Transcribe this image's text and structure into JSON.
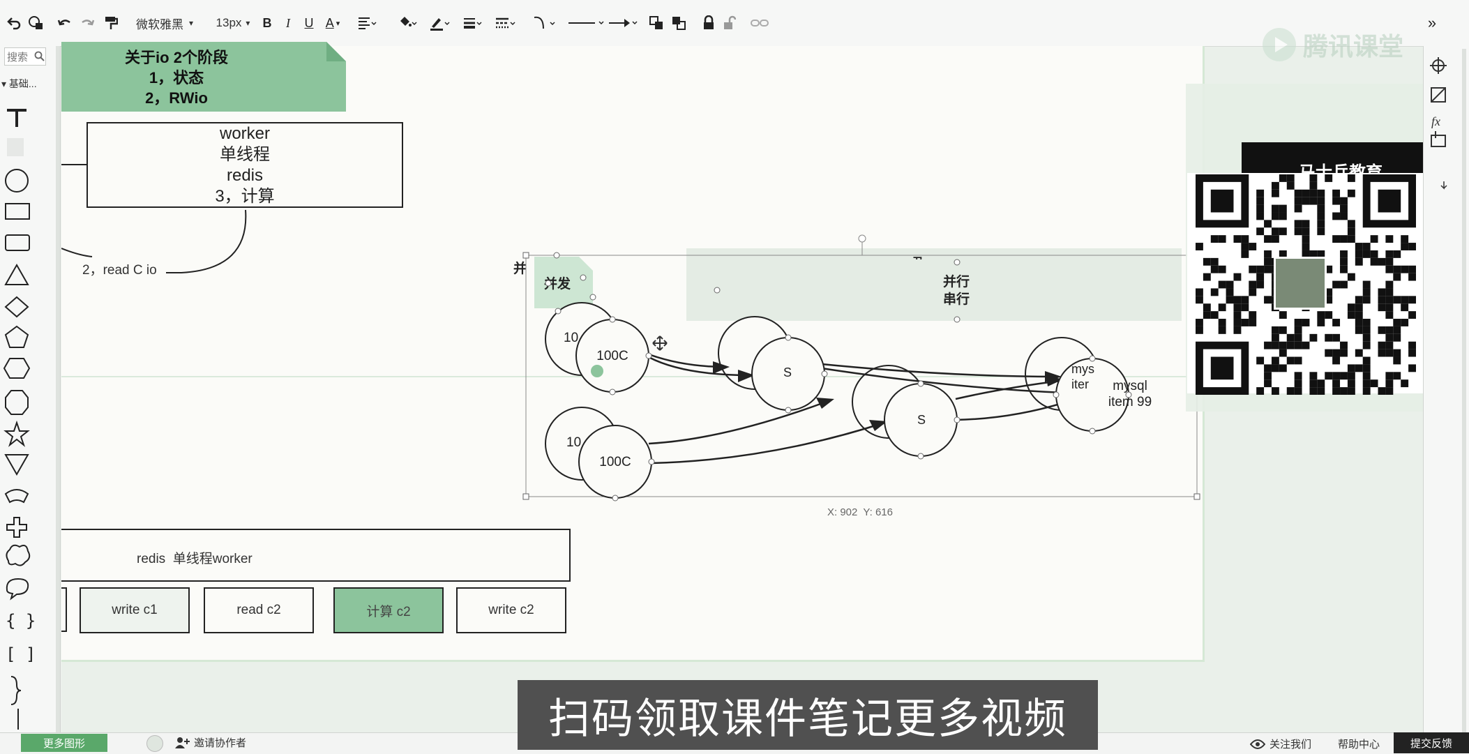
{
  "toolbar": {
    "font_name": "微软雅黑",
    "font_size": "13px",
    "bold": "B",
    "italic": "I",
    "underline": "U",
    "font_color": "A"
  },
  "left_panel": {
    "search_placeholder": "搜索",
    "category": "基础..."
  },
  "canvas": {
    "note_title": "关于io  2个阶段",
    "note_line1": "1，状态",
    "note_line2": "2，RWio",
    "worker_box": [
      "worker",
      "单线程",
      "redis",
      "3，计算"
    ],
    "read_label": "2，read C io",
    "bing_partial": "并",
    "bingfa": "并发",
    "bingxing": "并行",
    "chuanxing": "串行",
    "top_partial": "丑",
    "circle_1000_partial": "10",
    "circle_1000": "100C",
    "circle_s": "S",
    "mysql_back": [
      "mys",
      "iter"
    ],
    "mysql": [
      "mysql",
      "item 99"
    ],
    "coords": "X: 902  Y: 616",
    "redis_bar": "redis  单线程worker",
    "write_c1": "write c1",
    "read_c2": "read c2",
    "calc_c2": "计算 c2",
    "write_c2": "write c2"
  },
  "promo": {
    "brand_header": "马士兵教育",
    "watermark": "腾讯课堂"
  },
  "statusbar": {
    "more_shapes": "更多图形",
    "invite": "邀请协作者",
    "follow": "关注我们",
    "help": "帮助中心",
    "feedback": "提交反馈"
  },
  "subtitle": "扫码领取课件笔记更多视频",
  "colors": {
    "accent_green": "#8cc49c",
    "button_green": "#5aa86a",
    "canvas_bg": "#fbfbf8"
  }
}
